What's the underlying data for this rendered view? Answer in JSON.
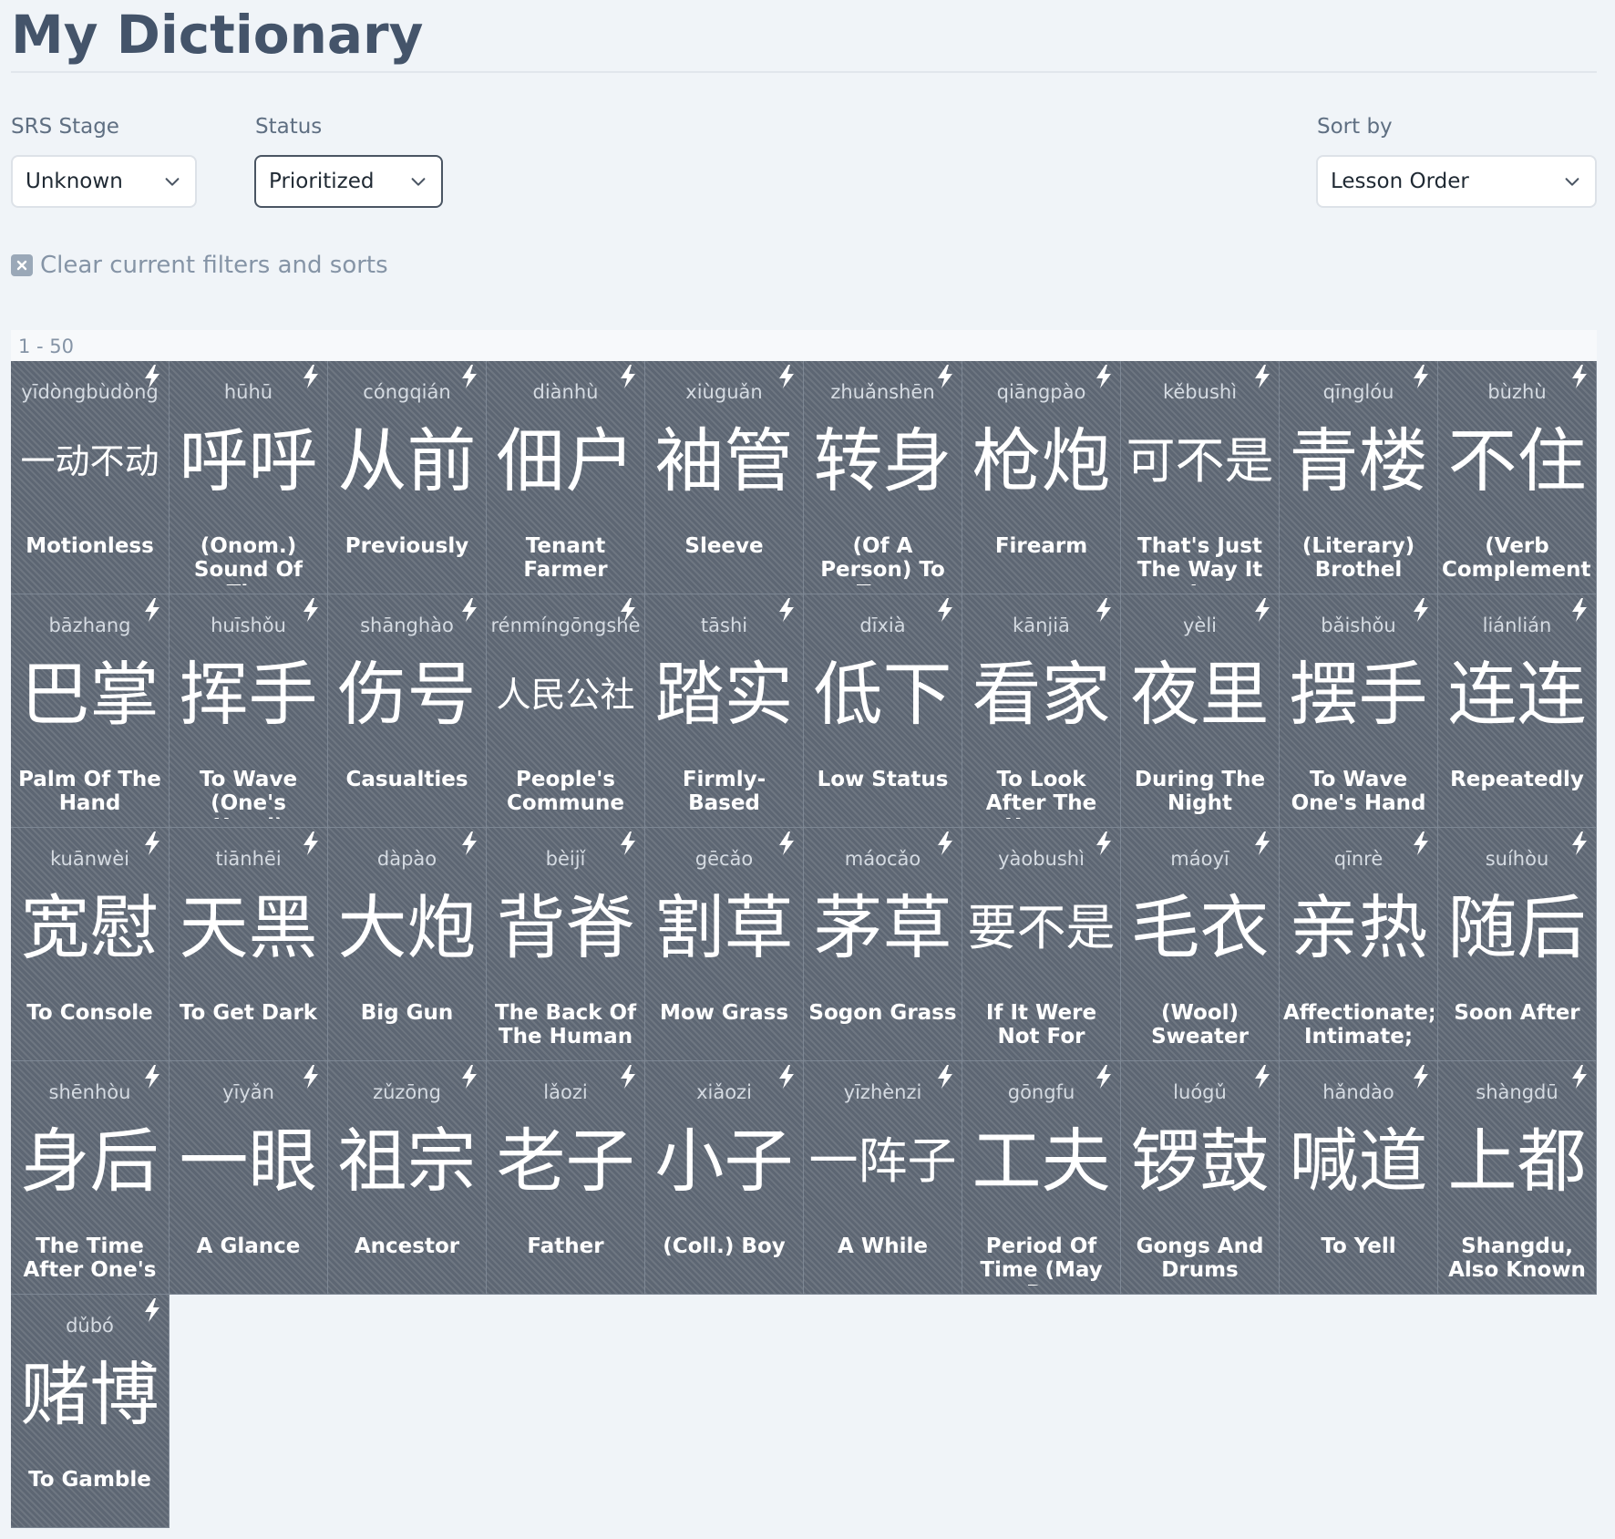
{
  "header": {
    "title": "My Dictionary"
  },
  "filters": {
    "srs_stage": {
      "label": "SRS Stage",
      "value": "Unknown"
    },
    "status": {
      "label": "Status",
      "value": "Prioritized"
    },
    "sort_by": {
      "label": "Sort by",
      "value": "Lesson Order"
    }
  },
  "clear_link": "Clear current filters and sorts",
  "range": "1 - 50",
  "cards": [
    {
      "pinyin": "yīdòngbùdòng",
      "hanzi": "一动不动",
      "meaning": "Motionless",
      "size": "small"
    },
    {
      "pinyin": "hūhū",
      "hanzi": "呼呼",
      "meaning": "(Onom.) Sound Of The",
      "size": ""
    },
    {
      "pinyin": "cóngqián",
      "hanzi": "从前",
      "meaning": "Previously",
      "size": ""
    },
    {
      "pinyin": "diànhù",
      "hanzi": "佃户",
      "meaning": "Tenant Farmer",
      "size": ""
    },
    {
      "pinyin": "xiùguǎn",
      "hanzi": "袖管",
      "meaning": "Sleeve",
      "size": ""
    },
    {
      "pinyin": "zhuǎnshēn",
      "hanzi": "转身",
      "meaning": "(Of A Person) To Turn",
      "size": ""
    },
    {
      "pinyin": "qiāngpào",
      "hanzi": "枪炮",
      "meaning": "Firearm",
      "size": ""
    },
    {
      "pinyin": "kěbushì",
      "hanzi": "可不是",
      "meaning": "That's Just The Way It Is",
      "size": "med"
    },
    {
      "pinyin": "qīnglóu",
      "hanzi": "青楼",
      "meaning": "(Literary) Brothel",
      "size": ""
    },
    {
      "pinyin": "bùzhù",
      "hanzi": "不住",
      "meaning": "(Verb Complement)",
      "size": ""
    },
    {
      "pinyin": "bāzhang",
      "hanzi": "巴掌",
      "meaning": "Palm Of The Hand",
      "size": ""
    },
    {
      "pinyin": "huīshǒu",
      "hanzi": "挥手",
      "meaning": "To Wave (One's Hand)",
      "size": ""
    },
    {
      "pinyin": "shānghào",
      "hanzi": "伤号",
      "meaning": "Casualties",
      "size": ""
    },
    {
      "pinyin": "rénmíngōngshè",
      "hanzi": "人民公社",
      "meaning": "People's Commune",
      "size": "small"
    },
    {
      "pinyin": "tāshi",
      "hanzi": "踏实",
      "meaning": "Firmly-Based",
      "size": ""
    },
    {
      "pinyin": "dīxià",
      "hanzi": "低下",
      "meaning": "Low Status",
      "size": ""
    },
    {
      "pinyin": "kānjiā",
      "hanzi": "看家",
      "meaning": "To Look After The House",
      "size": ""
    },
    {
      "pinyin": "yèli",
      "hanzi": "夜里",
      "meaning": "During The Night",
      "size": ""
    },
    {
      "pinyin": "bǎishǒu",
      "hanzi": "摆手",
      "meaning": "To Wave One's Hand",
      "size": ""
    },
    {
      "pinyin": "liánlián",
      "hanzi": "连连",
      "meaning": "Repeatedly",
      "size": ""
    },
    {
      "pinyin": "kuānwèi",
      "hanzi": "宽慰",
      "meaning": "To Console",
      "size": ""
    },
    {
      "pinyin": "tiānhēi",
      "hanzi": "天黑",
      "meaning": "To Get Dark",
      "size": ""
    },
    {
      "pinyin": "dàpào",
      "hanzi": "大炮",
      "meaning": "Big Gun",
      "size": ""
    },
    {
      "pinyin": "bèijǐ",
      "hanzi": "背脊",
      "meaning": "The Back Of The Human",
      "size": ""
    },
    {
      "pinyin": "gēcǎo",
      "hanzi": "割草",
      "meaning": "Mow Grass",
      "size": ""
    },
    {
      "pinyin": "máocǎo",
      "hanzi": "茅草",
      "meaning": "Sogon Grass",
      "size": ""
    },
    {
      "pinyin": "yàobushì",
      "hanzi": "要不是",
      "meaning": "If It Were Not For",
      "size": "med"
    },
    {
      "pinyin": "máoyī",
      "hanzi": "毛衣",
      "meaning": "(Wool) Sweater",
      "size": ""
    },
    {
      "pinyin": "qīnrè",
      "hanzi": "亲热",
      "meaning": "Affectionate; Intimate;",
      "size": ""
    },
    {
      "pinyin": "suíhòu",
      "hanzi": "随后",
      "meaning": "Soon After",
      "size": ""
    },
    {
      "pinyin": "shēnhòu",
      "hanzi": "身后",
      "meaning": "The Time After One's",
      "size": ""
    },
    {
      "pinyin": "yīyǎn",
      "hanzi": "一眼",
      "meaning": "A Glance",
      "size": ""
    },
    {
      "pinyin": "zǔzōng",
      "hanzi": "祖宗",
      "meaning": "Ancestor",
      "size": ""
    },
    {
      "pinyin": "lǎozi",
      "hanzi": "老子",
      "meaning": "Father",
      "size": ""
    },
    {
      "pinyin": "xiǎozi",
      "hanzi": "小子",
      "meaning": "(Coll.) Boy",
      "size": ""
    },
    {
      "pinyin": "yīzhènzi",
      "hanzi": "一阵子",
      "meaning": "A While",
      "size": "med"
    },
    {
      "pinyin": "gōngfu",
      "hanzi": "工夫",
      "meaning": "Period Of Time (May Be",
      "size": ""
    },
    {
      "pinyin": "luógǔ",
      "hanzi": "锣鼓",
      "meaning": "Gongs And Drums",
      "size": ""
    },
    {
      "pinyin": "hǎndào",
      "hanzi": "喊道",
      "meaning": "To Yell",
      "size": ""
    },
    {
      "pinyin": "shàngdū",
      "hanzi": "上都",
      "meaning": "Shangdu, Also Known",
      "size": ""
    },
    {
      "pinyin": "dǔbó",
      "hanzi": "赌博",
      "meaning": "To Gamble",
      "size": ""
    }
  ]
}
